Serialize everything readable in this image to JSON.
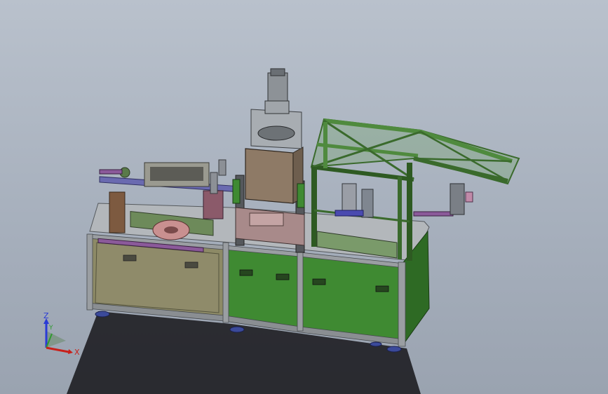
{
  "scene": {
    "colors": {
      "background_top": "#b9c1cc",
      "background_bottom": "#9aa3b0",
      "shadow": "#1e1e22",
      "olive_panel": "#8d8a66",
      "green_panel": "#3f8a32",
      "frame_green": "#4f8a3e",
      "frame_steel": "#8f9499",
      "housing_brown": "#8e7a66",
      "foot_blue": "#3b4a9a",
      "purple_accent": "#8b5a9a"
    }
  },
  "triad": {
    "z_label": "Z",
    "y_label": "Y",
    "x_label": "X",
    "z_color": "#2a3bd6",
    "y_color": "#2f9a2f",
    "x_color": "#c8201a"
  }
}
